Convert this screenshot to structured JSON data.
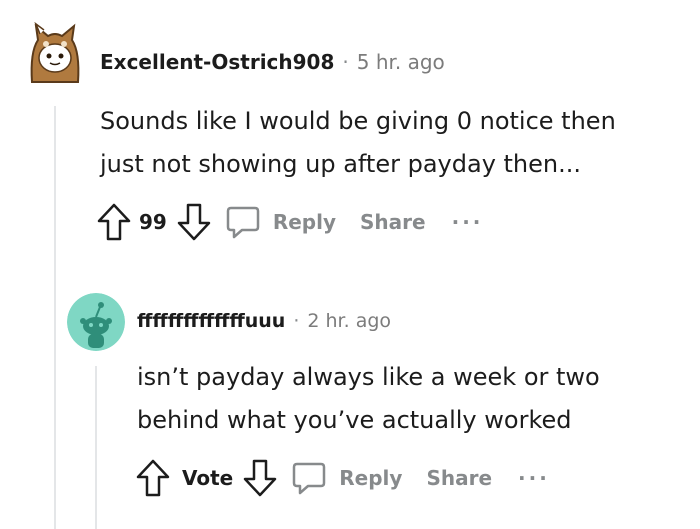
{
  "comments": [
    {
      "username": "Excellent-Ostrich908",
      "separator": "·",
      "time": "5 hr. ago",
      "body_lines": [
        "Sounds like I would be giving 0 notice then",
        "just not showing up after payday then..."
      ],
      "votes": "99",
      "reply_label": "Reply",
      "share_label": "Share",
      "more_label": "···",
      "avatar_icon": "fox-costume-snoo-avatar-icon"
    },
    {
      "username": "ffffffffffffffuuu",
      "separator": "·",
      "time": "2 hr. ago",
      "body_lines": [
        "isn’t payday always like a week or two",
        "behind what you’ve actually worked"
      ],
      "votes": "Vote",
      "reply_label": "Reply",
      "share_label": "Share",
      "more_label": "···",
      "avatar_icon": "default-snoo-avatar-icon"
    }
  ],
  "colors": {
    "text": "#1c1c1c",
    "muted": "#878a8c",
    "thread_line": "#e4e6e8",
    "avatar_teal": "#7fd7c4",
    "avatar_fox": "#b07a3f"
  }
}
